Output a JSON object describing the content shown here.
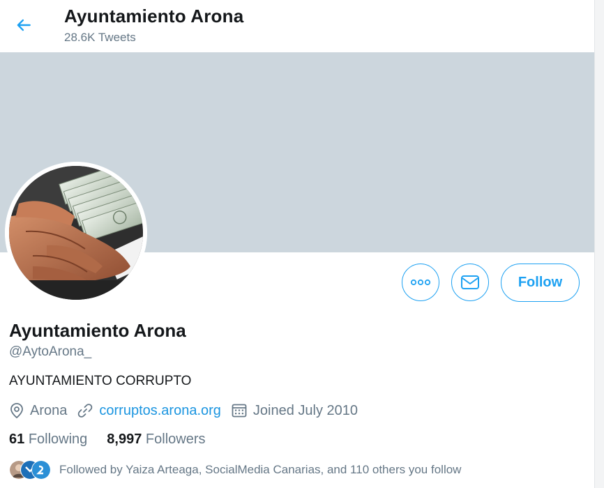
{
  "header": {
    "title": "Ayuntamiento Arona",
    "tweet_count": "28.6K Tweets"
  },
  "profile": {
    "display_name": "Ayuntamiento Arona",
    "handle": "@AytoArona_",
    "bio": "AYUNTAMIENTO CORRUPTO",
    "location": "Arona",
    "website": "corruptos.arona.org",
    "joined": "Joined July 2010"
  },
  "actions": {
    "follow_label": "Follow",
    "more_icon": "more-horizontal-icon",
    "message_icon": "mail-icon"
  },
  "stats": {
    "following_count": "61",
    "following_label": "Following",
    "followers_count": "8,997",
    "followers_label": "Followers"
  },
  "followed_by": {
    "text": "Followed by Yaiza Arteaga, SocialMedia Canarias, and 110 others you follow"
  },
  "colors": {
    "accent": "#1da1f2",
    "banner": "#ccd6dd",
    "secondary_text": "#657786"
  }
}
